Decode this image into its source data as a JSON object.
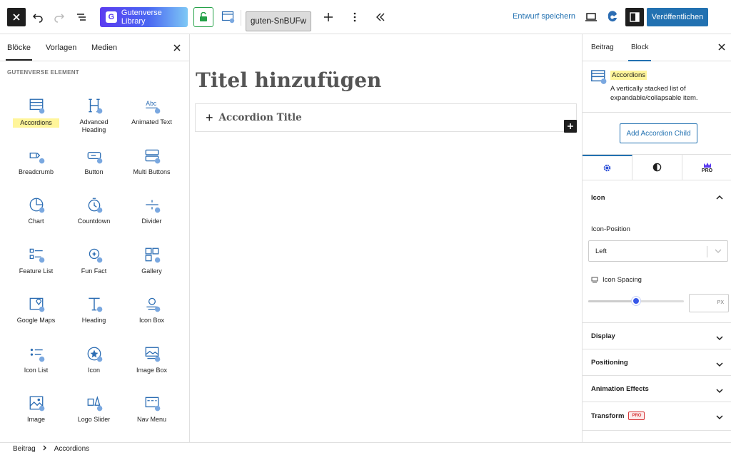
{
  "toolbar": {
    "library_label": "Gutenverse Library",
    "document_title": "guten-SnBUFw",
    "save_draft": "Entwurf speichern",
    "publish": "Veröffentlichen"
  },
  "inserter": {
    "tabs": [
      "Blöcke",
      "Vorlagen",
      "Medien"
    ],
    "section_title": "GUTENVERSE ELEMENT",
    "blocks": [
      {
        "label": "Accordions",
        "icon": "accordions-icon",
        "selected": true
      },
      {
        "label": "Advanced Heading",
        "icon": "advanced-heading-icon"
      },
      {
        "label": "Animated Text",
        "icon": "animated-text-icon"
      },
      {
        "label": "Breadcrumb",
        "icon": "breadcrumb-icon"
      },
      {
        "label": "Button",
        "icon": "button-icon"
      },
      {
        "label": "Multi Buttons",
        "icon": "multi-buttons-icon"
      },
      {
        "label": "Chart",
        "icon": "chart-icon"
      },
      {
        "label": "Countdown",
        "icon": "countdown-icon"
      },
      {
        "label": "Divider",
        "icon": "divider-icon"
      },
      {
        "label": "Feature List",
        "icon": "feature-list-icon"
      },
      {
        "label": "Fun Fact",
        "icon": "fun-fact-icon"
      },
      {
        "label": "Gallery",
        "icon": "gallery-icon"
      },
      {
        "label": "Google Maps",
        "icon": "google-maps-icon"
      },
      {
        "label": "Heading",
        "icon": "heading-icon"
      },
      {
        "label": "Icon Box",
        "icon": "icon-box-icon"
      },
      {
        "label": "Icon List",
        "icon": "icon-list-icon"
      },
      {
        "label": "Icon",
        "icon": "icon-icon"
      },
      {
        "label": "Image Box",
        "icon": "image-box-icon"
      },
      {
        "label": "Image",
        "icon": "image-icon"
      },
      {
        "label": "Logo Slider",
        "icon": "logo-slider-icon"
      },
      {
        "label": "Nav Menu",
        "icon": "nav-menu-icon"
      }
    ]
  },
  "canvas": {
    "title_placeholder": "Titel hinzufügen",
    "accordion_title": "Accordion Title"
  },
  "sidebar": {
    "tabs": [
      "Beitrag",
      "Block"
    ],
    "block_name": "Accordions",
    "block_description": "A vertically stacked list of expandable/collapsable item.",
    "add_child": "Add Accordion Child",
    "pro_tab_label": "PRO",
    "icon_panel": {
      "title": "Icon",
      "position_label": "Icon-Position",
      "position_value": "Left",
      "spacing_label": "Icon Spacing",
      "spacing_unit": "PX",
      "spacing_slider_fraction": 0.5
    },
    "panels": [
      "Display",
      "Positioning",
      "Animation Effects",
      "Transform"
    ],
    "pro_badge": "PRO"
  },
  "statusbar": {
    "crumbs": [
      "Beitrag",
      "Accordions"
    ]
  },
  "colors": {
    "accent": "#2271b1",
    "highlight": "#fff59a",
    "slider_thumb": "#3858e9",
    "pro_red": "#d63638"
  }
}
